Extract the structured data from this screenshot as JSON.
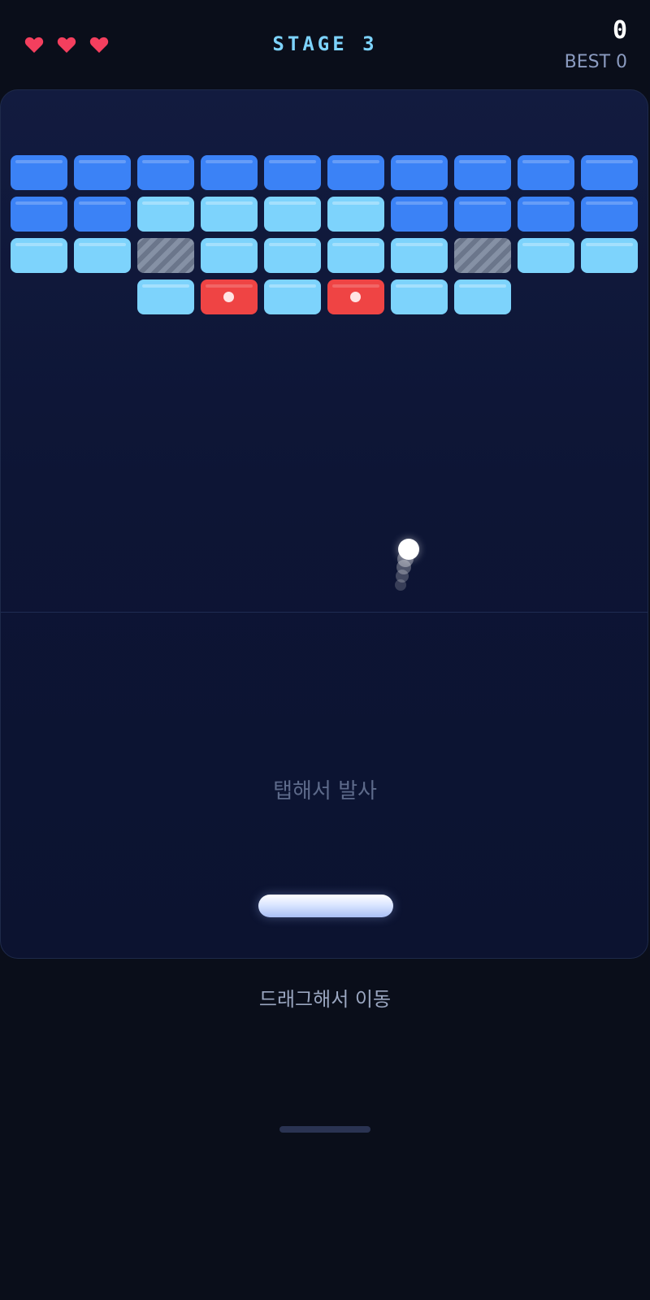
{
  "header": {
    "lives": 3,
    "stage_label": "STAGE 3",
    "score": "0",
    "best_label": "BEST 0"
  },
  "colors": {
    "heart": "#f43f5e",
    "brick_blue": "#3b82f6",
    "brick_light": "#7dd3fc",
    "brick_red": "#ef4444",
    "stage_text": "#7dd3fc"
  },
  "bricks": {
    "rows": [
      [
        "blue",
        "blue",
        "blue",
        "blue",
        "blue",
        "blue",
        "blue",
        "blue",
        "blue",
        "blue"
      ],
      [
        "blue",
        "blue",
        "light",
        "light",
        "light",
        "light",
        "blue",
        "blue",
        "blue",
        "blue"
      ],
      [
        "light",
        "light",
        "steel",
        "light",
        "light",
        "light",
        "light",
        "steel",
        "light",
        "light"
      ],
      [
        null,
        null,
        "light",
        "red",
        "light",
        "red",
        "light",
        "light",
        null,
        null
      ]
    ]
  },
  "hints": {
    "tap": "탭해서 발사",
    "drag": "드래그해서 이동"
  }
}
